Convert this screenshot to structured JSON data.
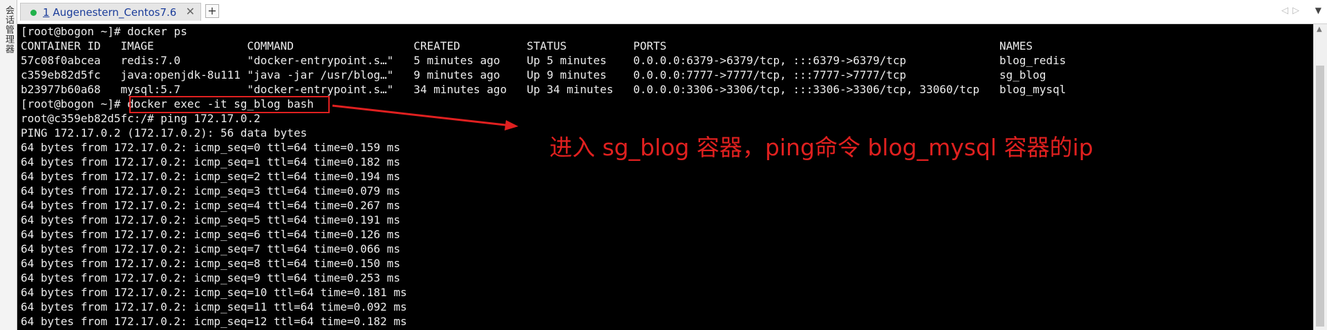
{
  "sidebar": {
    "label": "会话管理器"
  },
  "tab": {
    "index": "1",
    "title": " Augenestern_Centos7.6",
    "close": "✕"
  },
  "tab_add": "+",
  "nav": {
    "prev": "◁",
    "next": "▷",
    "menu": "▼"
  },
  "terminal": {
    "lines": [
      "[root@bogon ~]# docker ps",
      "CONTAINER ID   IMAGE              COMMAND                  CREATED          STATUS          PORTS                                                  NAMES",
      "57c08f0abcea   redis:7.0          \"docker-entrypoint.s…\"   5 minutes ago    Up 5 minutes    0.0.0.0:6379->6379/tcp, :::6379->6379/tcp              blog_redis",
      "c359eb82d5fc   java:openjdk-8u111 \"java -jar /usr/blog…\"   9 minutes ago    Up 9 minutes    0.0.0.0:7777->7777/tcp, :::7777->7777/tcp              sg_blog",
      "b23977b60a68   mysql:5.7          \"docker-entrypoint.s…\"   34 minutes ago   Up 34 minutes   0.0.0.0:3306->3306/tcp, :::3306->3306/tcp, 33060/tcp   blog_mysql",
      "[root@bogon ~]# docker exec -it sg_blog bash",
      "root@c359eb82d5fc:/# ping 172.17.0.2",
      "PING 172.17.0.2 (172.17.0.2): 56 data bytes",
      "64 bytes from 172.17.0.2: icmp_seq=0 ttl=64 time=0.159 ms",
      "64 bytes from 172.17.0.2: icmp_seq=1 ttl=64 time=0.182 ms",
      "64 bytes from 172.17.0.2: icmp_seq=2 ttl=64 time=0.194 ms",
      "64 bytes from 172.17.0.2: icmp_seq=3 ttl=64 time=0.079 ms",
      "64 bytes from 172.17.0.2: icmp_seq=4 ttl=64 time=0.267 ms",
      "64 bytes from 172.17.0.2: icmp_seq=5 ttl=64 time=0.191 ms",
      "64 bytes from 172.17.0.2: icmp_seq=6 ttl=64 time=0.126 ms",
      "64 bytes from 172.17.0.2: icmp_seq=7 ttl=64 time=0.066 ms",
      "64 bytes from 172.17.0.2: icmp_seq=8 ttl=64 time=0.150 ms",
      "64 bytes from 172.17.0.2: icmp_seq=9 ttl=64 time=0.253 ms",
      "64 bytes from 172.17.0.2: icmp_seq=10 ttl=64 time=0.181 ms",
      "64 bytes from 172.17.0.2: icmp_seq=11 ttl=64 time=0.092 ms",
      "64 bytes from 172.17.0.2: icmp_seq=12 ttl=64 time=0.182 ms"
    ]
  },
  "annotation": {
    "text": "进入 sg_blog 容器，ping命令 blog_mysql 容器的ip"
  },
  "colors": {
    "terminal_bg": "#000000",
    "terminal_fg": "#ececec",
    "highlight": "#e02020",
    "status_dot": "#21b24b"
  }
}
